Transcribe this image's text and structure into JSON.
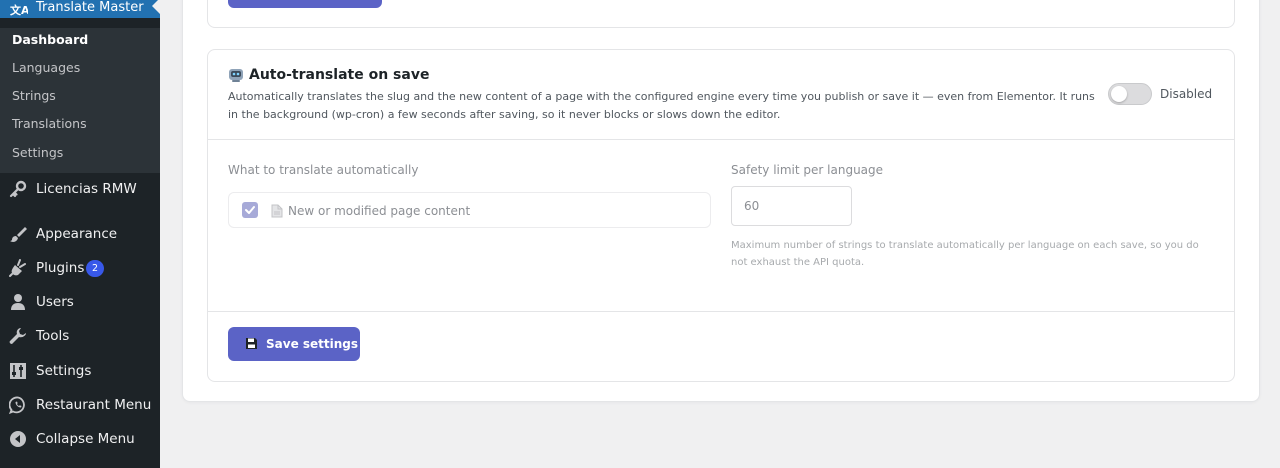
{
  "sidebar": {
    "active_plugin": {
      "label": "Translate Master",
      "icon": "translate-icon"
    },
    "submenu": [
      {
        "label": "Dashboard",
        "current": true
      },
      {
        "label": "Languages"
      },
      {
        "label": "Strings"
      },
      {
        "label": "Translations"
      },
      {
        "label": "Settings"
      }
    ],
    "items": [
      {
        "label": "Licencias RMW",
        "icon": "key-icon"
      },
      {
        "label": "Appearance",
        "icon": "paintbrush-icon"
      },
      {
        "label": "Plugins",
        "icon": "plugin-icon",
        "badge": "2"
      },
      {
        "label": "Users",
        "icon": "user-icon"
      },
      {
        "label": "Tools",
        "icon": "wrench-icon"
      },
      {
        "label": "Settings",
        "icon": "sliders-icon"
      },
      {
        "label": "Restaurant Menu",
        "icon": "whatsapp-icon"
      },
      {
        "label": "Collapse Menu",
        "icon": "collapse-icon"
      }
    ]
  },
  "section": {
    "icon": "robot-icon",
    "title": "Auto-translate on save",
    "description": "Automatically translates the slug and the new content of a page with the configured engine every time you publish or save it — even from Elementor. It runs in the background (wp-cron) a few seconds after saving, so it never blocks or slows down the editor.",
    "toggle_label": "Disabled",
    "toggle_on": false
  },
  "fields": {
    "what_label": "What to translate automatically",
    "checkbox_label": "New or modified page content",
    "checkbox_checked": true,
    "limit_label": "Safety limit per language",
    "limit_value": "60",
    "limit_help": "Maximum number of strings to translate automatically per language on each save, so you do not exhaust the API quota."
  },
  "actions": {
    "save_label": "Save settings",
    "save_icon": "floppy-disk-icon"
  },
  "colors": {
    "accent": "#5b63c6",
    "sidebar_bg": "#1d2327",
    "submenu_bg": "#2c3338",
    "active_blue": "#2271b1",
    "badge": "#3858e9"
  }
}
